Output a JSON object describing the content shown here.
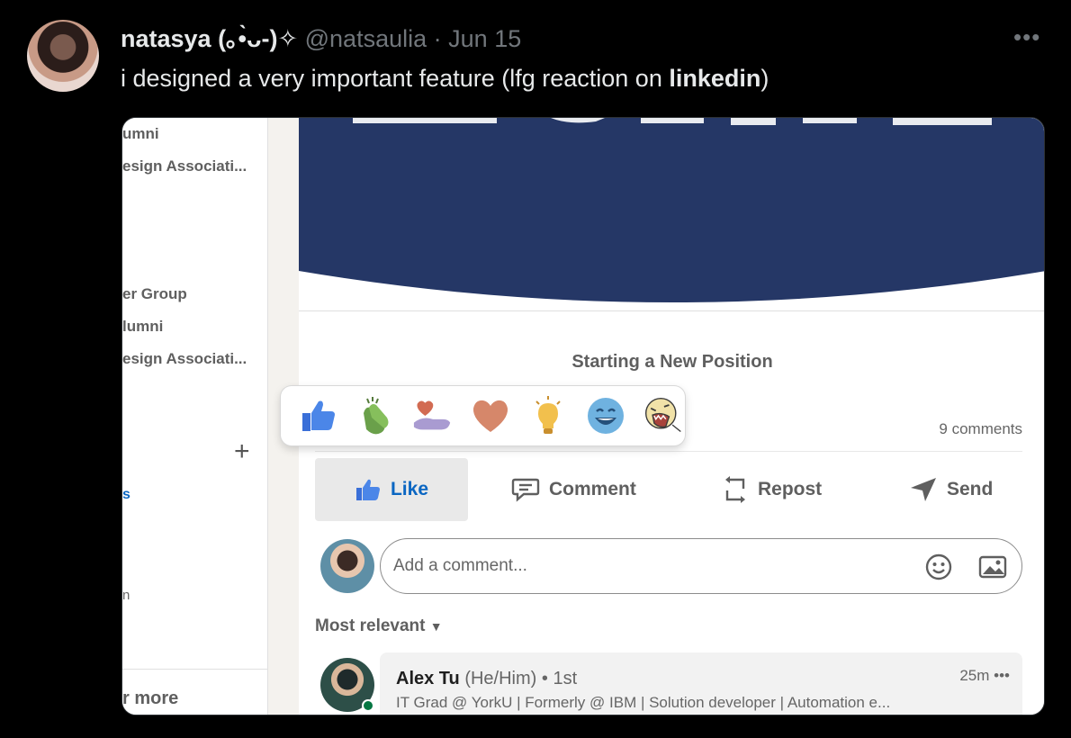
{
  "tweet": {
    "author_name": "natasya (｡•̀ᴗ-)✧",
    "handle": "@natsaulia",
    "separator": "·",
    "date": "Jun 15",
    "more_label": "•••",
    "text_before": "i designed a very important feature (lfg reaction on ",
    "text_bold": "linkedin",
    "text_after": ")"
  },
  "sidebar": {
    "items": [
      "umni",
      "esign Associati...",
      "er Group",
      "lumni",
      "esign Associati..."
    ],
    "plus_label": "+",
    "blue_fragment": "s",
    "small_fragment": "n",
    "more_label": "r more"
  },
  "post": {
    "position_title": "Starting a New Position",
    "comments_count": "9 comments",
    "actions": {
      "like": "Like",
      "comment": "Comment",
      "repost": "Repost",
      "send": "Send"
    },
    "comment_placeholder": "Add a comment...",
    "sort_label": "Most relevant",
    "reactions": [
      "like-icon",
      "clap-icon",
      "support-icon",
      "love-icon",
      "insightful-icon",
      "funny-icon",
      "lfg-icon"
    ],
    "comment": {
      "name": "Alex Tu",
      "pronouns": "(He/Him)",
      "degree": "• 1st",
      "time": "25m •••",
      "headline": "IT Grad @ YorkU | Formerly @ IBM | Solution developer | Automation e..."
    }
  },
  "colors": {
    "banner_navy": "#253766",
    "linkedin_blue": "#0a66c2",
    "twitter_gray": "#71767b"
  }
}
